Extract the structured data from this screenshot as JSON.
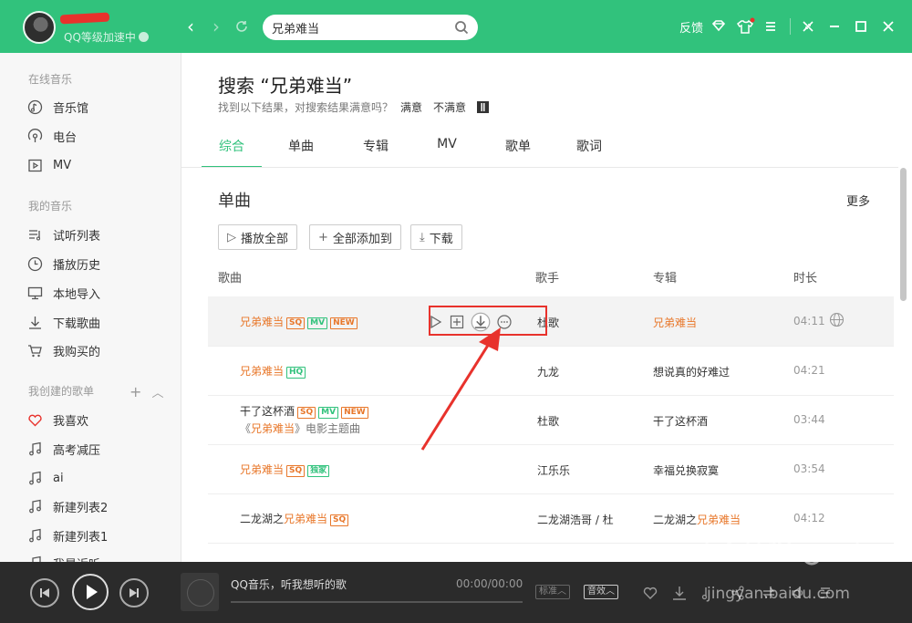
{
  "header": {
    "vip_text": "QQ等级加速中",
    "search_value": "兄弟难当",
    "feedback_label": "反馈"
  },
  "sidebar": {
    "online_title": "在线音乐",
    "online_items": [
      {
        "label": "音乐馆",
        "icon": "music-hall-icon"
      },
      {
        "label": "电台",
        "icon": "radio-icon"
      },
      {
        "label": "MV",
        "icon": "mv-icon"
      }
    ],
    "my_title": "我的音乐",
    "my_items": [
      {
        "label": "试听列表",
        "icon": "playlist-icon"
      },
      {
        "label": "播放历史",
        "icon": "history-clock-icon"
      },
      {
        "label": "本地导入",
        "icon": "monitor-icon"
      },
      {
        "label": "下载歌曲",
        "icon": "download-icon"
      },
      {
        "label": "我购买的",
        "icon": "cart-icon"
      }
    ],
    "created_title": "我创建的歌单",
    "created_items": [
      {
        "label": "我喜欢",
        "icon": "heart-icon"
      },
      {
        "label": "高考减压",
        "icon": "music-note-icon"
      },
      {
        "label": "ai",
        "icon": "music-note-icon"
      },
      {
        "label": "新建列表2",
        "icon": "music-note-icon"
      },
      {
        "label": "新建列表1",
        "icon": "music-note-icon"
      },
      {
        "label": "我最近听",
        "icon": "music-note-icon"
      }
    ]
  },
  "main": {
    "search_title": "搜索 “兄弟难当”",
    "feedback_prompt": "找到以下结果，对搜索结果满意吗？",
    "satisfied": "满意",
    "unsatisfied": "不满意",
    "tabs": [
      "综合",
      "单曲",
      "专辑",
      "MV",
      "歌单",
      "歌词"
    ],
    "section_title": "单曲",
    "more": "更多",
    "buttons": {
      "play_all": "播放全部",
      "add_all": "全部添加到",
      "download": "下载"
    },
    "columns": {
      "song": "歌曲",
      "singer": "歌手",
      "album": "专辑",
      "duration": "时长"
    },
    "songs": [
      {
        "name": "兄弟难当",
        "tags": [
          "SQ",
          "MV",
          "NEW"
        ],
        "singer": "杜歌",
        "album": "兄弟难当",
        "duration": "04:11"
      },
      {
        "name": "兄弟难当",
        "tags": [
          "HQ"
        ],
        "singer": "九龙",
        "album": "想说真的好难过",
        "duration": "04:21"
      },
      {
        "name": "干了这杯酒",
        "tags": [
          "SQ",
          "MV",
          "NEW"
        ],
        "subtitle_pre": "《",
        "subtitle_hi": "兄弟难当",
        "subtitle_post": "》电影主题曲",
        "singer": "杜歌",
        "album": "干了这杯酒",
        "duration": "03:44"
      },
      {
        "name": "兄弟难当",
        "tags": [
          "SQ",
          "独家"
        ],
        "singer": "江乐乐",
        "album": "幸福兑换寂寞",
        "duration": "03:54"
      },
      {
        "name_pre": "二龙湖之",
        "name_hi": "兄弟难当",
        "tags": [
          "SQ"
        ],
        "singer": "二龙湖浩哥 / 杜",
        "album_pre": "二龙湖之",
        "album_hi": "兄弟难当",
        "duration": "04:12"
      }
    ]
  },
  "player": {
    "track_text": "QQ音乐，听我想听的歌",
    "time_current": "00:00",
    "time_total": "00:00",
    "quality": "标准",
    "effect": "音效"
  },
  "colors": {
    "brand": "#31c27c",
    "highlight": "#e8772a",
    "annotation": "#e8322c",
    "player_bg": "#2b2b2b"
  }
}
